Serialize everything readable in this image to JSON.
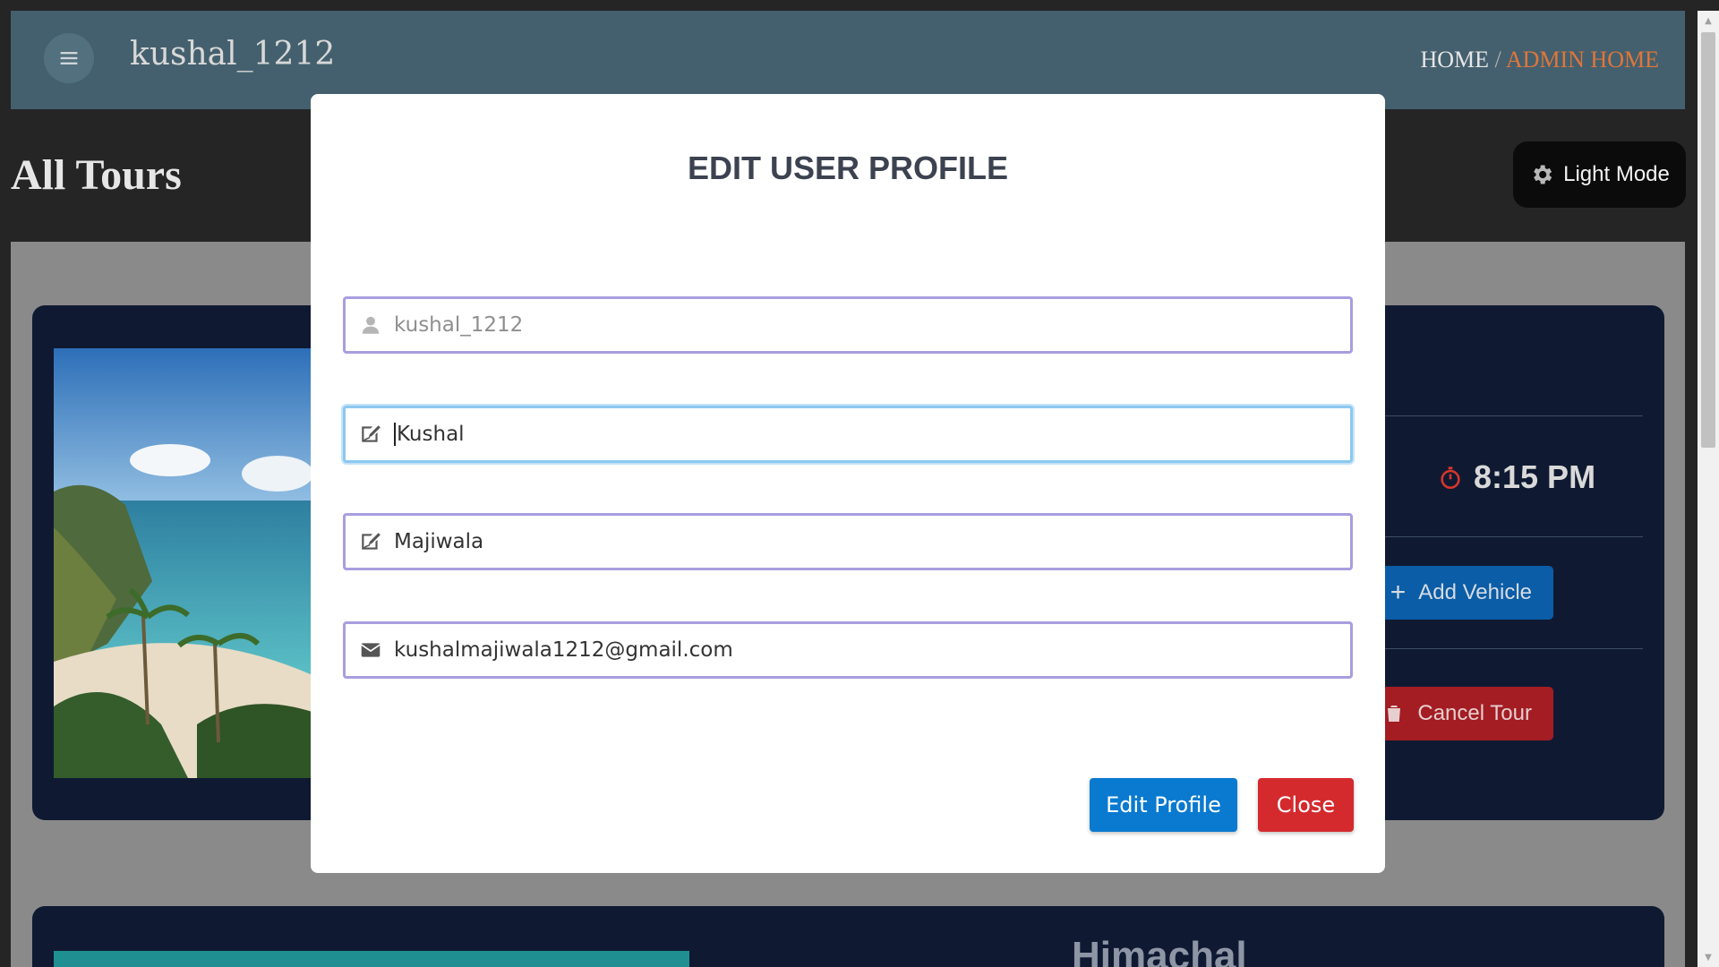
{
  "header": {
    "username": "kushal_1212",
    "breadcrumb_home": "HOME",
    "breadcrumb_separator": "/",
    "breadcrumb_active": "ADMIN HOME"
  },
  "page": {
    "title": "All Tours",
    "theme_toggle_label": "Light Mode"
  },
  "tour_card": {
    "time": "8:15 PM",
    "add_vehicle_label": "Add Vehicle",
    "cancel_tour_label": "Cancel Tour"
  },
  "tour_card_2": {
    "title": "Himachal"
  },
  "modal": {
    "title": "EDIT USER PROFILE",
    "fields": [
      {
        "icon": "user-icon",
        "value": "kushal_1212"
      },
      {
        "icon": "signature-icon",
        "value": "Kushal"
      },
      {
        "icon": "signature-icon",
        "value": "Majiwala"
      },
      {
        "icon": "envelope-icon",
        "value": "kushalmajiwala1212@gmail.com"
      }
    ],
    "edit_button_label": "Edit Profile",
    "close_button_label": "Close"
  },
  "colors": {
    "primary_blue": "#0a7ad0",
    "danger_red": "#d42a2e",
    "field_border": "#a89ee0",
    "focus_border": "#8cc8f0",
    "accent_orange": "#e0763a"
  }
}
